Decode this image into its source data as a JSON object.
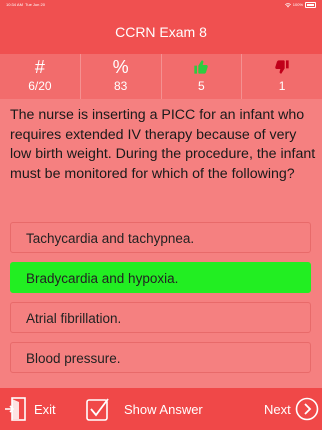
{
  "status_bar": {
    "time": "10:34 AM",
    "date": "Tue Jun 20",
    "wifi_icon": "wifi-icon",
    "battery_percent": "100%"
  },
  "header": {
    "title": "CCRN Exam 8"
  },
  "stats": {
    "count_symbol": "#",
    "count_value": "6/20",
    "percent_symbol": "%",
    "percent_value": "83",
    "correct_value": "5",
    "incorrect_value": "1"
  },
  "question": {
    "text": "The nurse is inserting a PICC for an infant who requires extended IV therapy because of very low birth weight. During the procedure, the infant must be monitored for which of the following?"
  },
  "answers": [
    {
      "label": "Tachycardia and tachypnea."
    },
    {
      "label": "Bradycardia and hypoxia."
    },
    {
      "label": "Atrial fibrillation."
    },
    {
      "label": "Blood pressure."
    }
  ],
  "bottom_bar": {
    "exit_label": "Exit",
    "show_answer_label": "Show Answer",
    "next_label": "Next"
  },
  "colors": {
    "background": "#f58080",
    "header": "#f05050",
    "correct_answer": "#22ee22",
    "thumbs_up": "#2ecc40",
    "thumbs_down": "#c0001a"
  }
}
